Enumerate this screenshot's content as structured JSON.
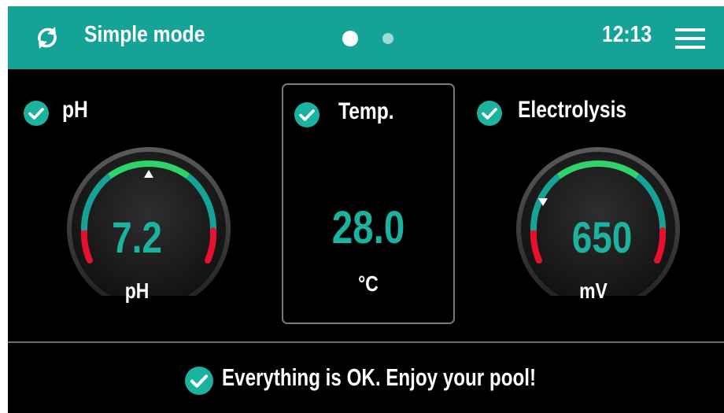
{
  "topbar": {
    "title": "Simple mode",
    "time": "12:13",
    "sync_icon": "sync-icon",
    "menu_icon": "hamburger-menu-icon",
    "pages": {
      "count": 2,
      "active": 1
    },
    "bg_color": "#14a396"
  },
  "panels": {
    "ph": {
      "label": "pH",
      "value": "7.2",
      "unit": "pH",
      "status_icon": "check-circle-icon",
      "marker": "up-triangle"
    },
    "temperature": {
      "label": "Temp.",
      "value": "28.0",
      "unit": "°C",
      "status_icon": "check-circle-icon"
    },
    "electrolysis": {
      "label": "Electrolysis",
      "value": "650",
      "unit": "mV",
      "status_icon": "check-circle-icon",
      "marker": "down-triangle"
    }
  },
  "status": {
    "message": "Everything is OK. Enjoy your pool!",
    "icon": "check-circle-icon"
  },
  "colors": {
    "accent": "#1bb39f",
    "ok_green": "#2ed46a",
    "alarm_red": "#e8112d",
    "background": "#000000"
  }
}
